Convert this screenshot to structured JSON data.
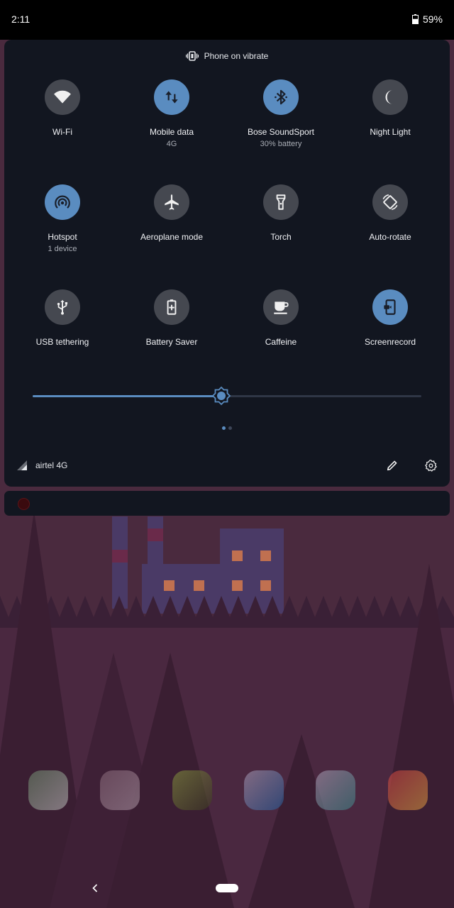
{
  "status_bar": {
    "time": "2:11",
    "battery_percent": "59%",
    "battery_level": 0.59
  },
  "quick_settings": {
    "ringer_status": "Phone on vibrate",
    "tiles": [
      {
        "label": "Wi-Fi",
        "sublabel": "",
        "icon": "wifi-icon",
        "active": false
      },
      {
        "label": "Mobile data",
        "sublabel": "4G",
        "icon": "mobile-data-icon",
        "active": true
      },
      {
        "label": "Bose SoundSport",
        "sublabel": "30% battery",
        "icon": "bluetooth-icon",
        "active": true
      },
      {
        "label": "Night Light",
        "sublabel": "",
        "icon": "night-light-icon",
        "active": false
      },
      {
        "label": "Hotspot",
        "sublabel": "1 device",
        "icon": "hotspot-icon",
        "active": true
      },
      {
        "label": "Aeroplane mode",
        "sublabel": "",
        "icon": "airplane-icon",
        "active": false
      },
      {
        "label": "Torch",
        "sublabel": "",
        "icon": "torch-icon",
        "active": false
      },
      {
        "label": "Auto-rotate",
        "sublabel": "",
        "icon": "auto-rotate-icon",
        "active": false
      },
      {
        "label": "USB tethering",
        "sublabel": "",
        "icon": "usb-icon",
        "active": false
      },
      {
        "label": "Battery Saver",
        "sublabel": "",
        "icon": "battery-saver-icon",
        "active": false
      },
      {
        "label": "Caffeine",
        "sublabel": "",
        "icon": "coffee-cup-icon",
        "active": false
      },
      {
        "label": "Screenrecord",
        "sublabel": "",
        "icon": "screen-record-icon",
        "active": true
      }
    ],
    "brightness_level": 0.485,
    "page_count": 2,
    "current_page": 1,
    "carrier": "airtel 4G",
    "colors": {
      "accent": "#5a8cc0",
      "panel": "#121620",
      "tile_off": "#454850"
    }
  },
  "dock": {
    "apps": [
      {
        "name": "launcher-app-icon",
        "colors": [
          "#6b8a6a",
          "#c0c0c0"
        ]
      },
      {
        "name": "play-movies-app-icon",
        "colors": [
          "#8a6a7a",
          "#b09aa8"
        ]
      },
      {
        "name": "spotify-app-icon",
        "colors": [
          "#8a9a40",
          "#3a3a20"
        ]
      },
      {
        "name": "play-store-app-icon",
        "colors": [
          "#b0a0b8",
          "#2060a0"
        ]
      },
      {
        "name": "camera-app-icon",
        "colors": [
          "#b0a0b8",
          "#3a8a8a"
        ]
      },
      {
        "name": "chrome-app-icon",
        "colors": [
          "#d04040",
          "#e0a040"
        ]
      }
    ]
  }
}
